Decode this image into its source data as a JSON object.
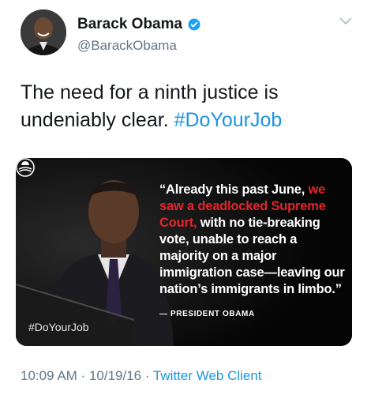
{
  "author": {
    "name": "Barack Obama",
    "handle": "@BarackObama",
    "verified_icon": "verified-badge-icon",
    "avatar_icon": "avatar"
  },
  "tweet": {
    "text_plain": "The need for a ninth justice is undeniably clear.",
    "hashtag": "#DoYourJob"
  },
  "media": {
    "quote_part1": "“Already this past June, ",
    "quote_red": "we saw a deadlocked Supreme Court,",
    "quote_part2": " with no tie-breaking vote, unable to reach a majority on a major immigration case—leaving our nation’s immigrants in limbo.”",
    "attribution": "— PRESIDENT OBAMA",
    "hashtag": "#DoYourJob"
  },
  "meta": {
    "time": "10:09 AM",
    "separator1": " · ",
    "date": "10/19/16",
    "separator2": " · ",
    "client": "Twitter Web Client"
  },
  "colors": {
    "link": "#1b95e0",
    "secondary": "#657786",
    "quote_red": "#e0262b"
  }
}
